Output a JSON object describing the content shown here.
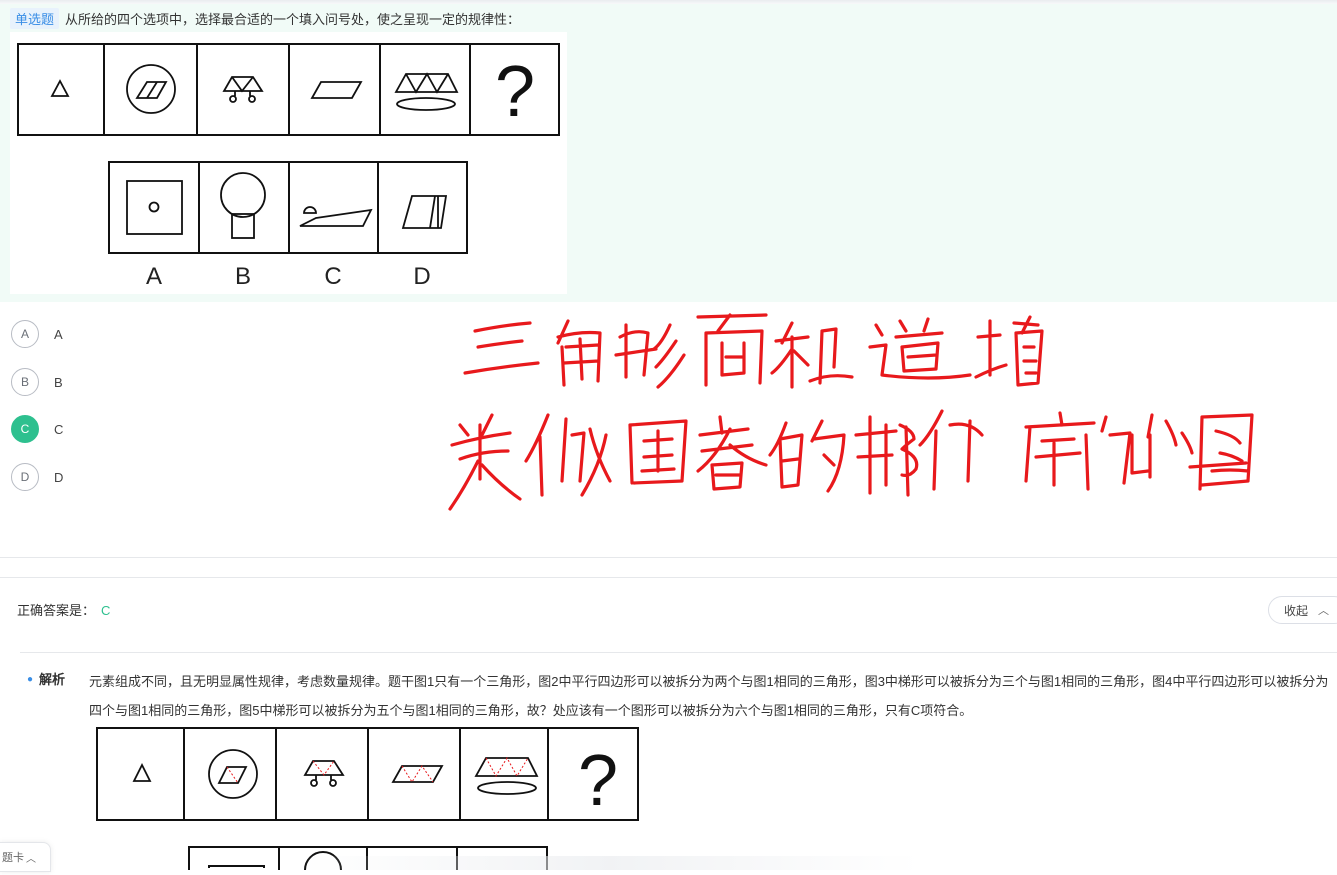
{
  "question": {
    "type_tag": "单选题",
    "stem": "从所给的四个选项中，选择最合适的一个填入问号处，使之呈现一定的规律性：",
    "figure_option_letters": [
      "A",
      "B",
      "C",
      "D"
    ],
    "question_mark": "?"
  },
  "options": [
    {
      "letter": "A",
      "label": "A",
      "selected": false
    },
    {
      "letter": "B",
      "label": "B",
      "selected": false
    },
    {
      "letter": "C",
      "label": "C",
      "selected": true
    },
    {
      "letter": "D",
      "label": "D",
      "selected": false
    }
  ],
  "handwriting": {
    "line1": "三角形面积递增",
    "line2": "类似国画的那个扇形图",
    "color": "#e8191c"
  },
  "answer": {
    "label": "正确答案是：",
    "value": "C",
    "collapse_label": "收起"
  },
  "analysis": {
    "tag": "解析",
    "text": "元素组成不同，且无明显属性规律，考虑数量规律。题干图1只有一个三角形，图2中平行四边形可以被拆分为两个与图1相同的三角形，图3中梯形可以被拆分为三个与图1相同的三角形，图4中平行四边形可以被拆分为四个与图1相同的三角形，图5中梯形可以被拆分为五个与图1相同的三角形，故？处应该有一个图形可以被拆分为六个与图1相同的三角形，只有C项符合。"
  },
  "answer_card_tab": "题卡",
  "colors": {
    "accent_green": "#2ec08f",
    "tag_blue": "#3a8ee6",
    "panel_bg": "#f1fbf7"
  }
}
